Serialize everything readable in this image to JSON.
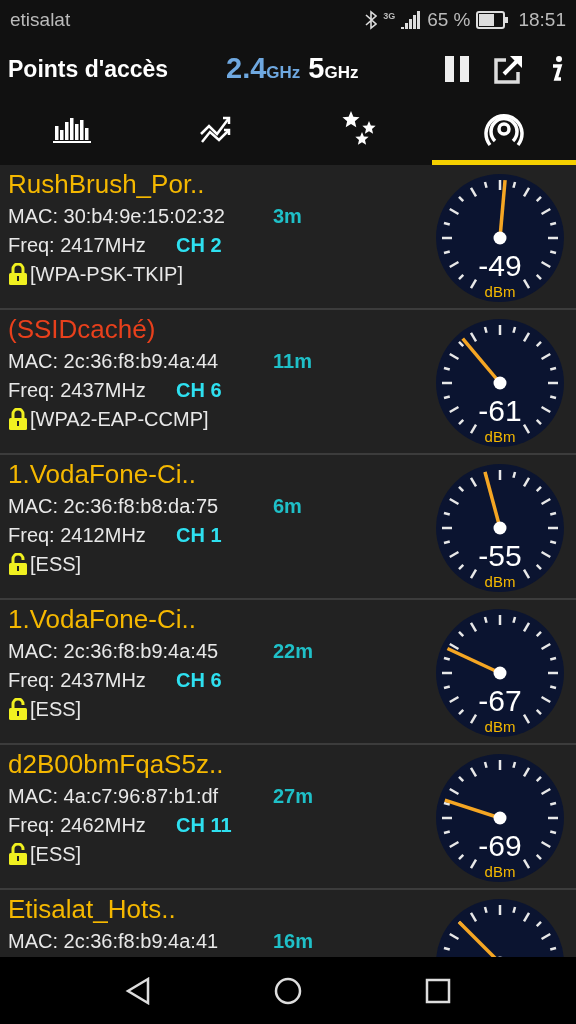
{
  "status_bar": {
    "carrier": "etisalat",
    "network": "3G",
    "battery": "65 %",
    "time": "18:51"
  },
  "header": {
    "title": "Points d'accès",
    "bands": [
      {
        "value": "2.4",
        "unit": "GHz",
        "selected": true
      },
      {
        "value": "5",
        "unit": "GHz",
        "selected": false
      }
    ]
  },
  "tabs": [
    {
      "selected": false
    },
    {
      "selected": false
    },
    {
      "selected": false
    },
    {
      "selected": true
    }
  ],
  "networks": [
    {
      "ssid": "RushBrush_Por..",
      "color": "#f5b800",
      "mac": "MAC: 30:b4:9e:15:02:32",
      "distance": "3m",
      "freq": "Freq: 2417MHz",
      "channel": "CH 2",
      "security": "[WPA-PSK-TKIP]",
      "locked": true,
      "reading": "-49",
      "unit": "dBm"
    },
    {
      "ssid": "(SSIDcaché)",
      "color": "#e8401c",
      "mac": "MAC: 2c:36:f8:b9:4a:44",
      "distance": "11m",
      "freq": "Freq: 2437MHz",
      "channel": "CH 6",
      "security": "[WPA2-EAP-CCMP]",
      "locked": true,
      "reading": "-61",
      "unit": "dBm"
    },
    {
      "ssid": "1.VodaFone-Ci..",
      "color": "#f5b800",
      "mac": "MAC: 2c:36:f8:b8:da:75",
      "distance": "6m",
      "freq": "Freq: 2412MHz",
      "channel": "CH 1",
      "security": "[ESS]",
      "locked": false,
      "reading": "-55",
      "unit": "dBm"
    },
    {
      "ssid": "1.VodaFone-Ci..",
      "color": "#f5b800",
      "mac": "MAC: 2c:36:f8:b9:4a:45",
      "distance": "22m",
      "freq": "Freq: 2437MHz",
      "channel": "CH 6",
      "security": "[ESS]",
      "locked": false,
      "reading": "-67",
      "unit": "dBm"
    },
    {
      "ssid": "d2B00bmFqaS5z..",
      "color": "#f5b800",
      "mac": "MAC: 4a:c7:96:87:b1:df",
      "distance": "27m",
      "freq": "Freq: 2462MHz",
      "channel": "CH 11",
      "security": "[ESS]",
      "locked": false,
      "reading": "-69",
      "unit": "dBm"
    },
    {
      "ssid": "Etisalat_Hots..",
      "color": "#f5b800",
      "mac": "MAC: 2c:36:f8:b9:4a:41",
      "distance": "16m"
    }
  ]
}
